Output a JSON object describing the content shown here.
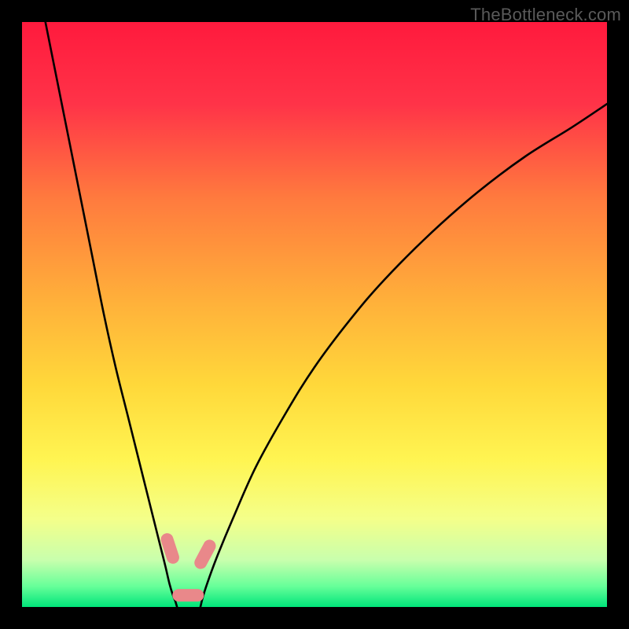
{
  "watermark": "TheBottleneck.com",
  "chart_data": {
    "type": "line",
    "title": "",
    "xlabel": "",
    "ylabel": "",
    "xlim": [
      0,
      100
    ],
    "ylim": [
      0,
      100
    ],
    "grid": false,
    "legend": false,
    "gradient_stops": [
      {
        "offset": 0,
        "color": "#ff1a3d"
      },
      {
        "offset": 0.14,
        "color": "#ff3348"
      },
      {
        "offset": 0.3,
        "color": "#ff7a3e"
      },
      {
        "offset": 0.48,
        "color": "#ffb13a"
      },
      {
        "offset": 0.62,
        "color": "#ffd83a"
      },
      {
        "offset": 0.75,
        "color": "#fff552"
      },
      {
        "offset": 0.85,
        "color": "#f4ff8a"
      },
      {
        "offset": 0.92,
        "color": "#c8ffad"
      },
      {
        "offset": 0.965,
        "color": "#66ff99"
      },
      {
        "offset": 1.0,
        "color": "#00e57a"
      }
    ],
    "series": [
      {
        "name": "left-branch",
        "x": [
          4,
          6,
          8,
          10,
          12,
          14,
          16,
          18,
          20,
          22,
          23.5,
          24.5,
          25.2,
          25.8,
          26.2,
          26.5
        ],
        "y": [
          100,
          90,
          80,
          70,
          60,
          50,
          41,
          33,
          25,
          17,
          11,
          7,
          4,
          2,
          1,
          0
        ]
      },
      {
        "name": "right-branch",
        "x": [
          30.5,
          31,
          32,
          33.5,
          36,
          40,
          45,
          50,
          56,
          62,
          70,
          78,
          86,
          94,
          100
        ],
        "y": [
          0,
          2,
          5,
          9,
          15,
          24,
          33,
          41,
          49,
          56,
          64,
          71,
          77,
          82,
          86
        ]
      }
    ],
    "markers": [
      {
        "name": "left-short-marker",
        "x": 25.3,
        "y": 10.0,
        "angle_deg": 72
      },
      {
        "name": "right-short-marker",
        "x": 31.3,
        "y": 9.0,
        "angle_deg": -62
      },
      {
        "name": "floor-marker",
        "x": 28.4,
        "y": 2.0,
        "angle_deg": 0
      }
    ],
    "marker_style": {
      "color": "#e9888a",
      "length": 40,
      "width": 16,
      "rx": 8
    }
  }
}
